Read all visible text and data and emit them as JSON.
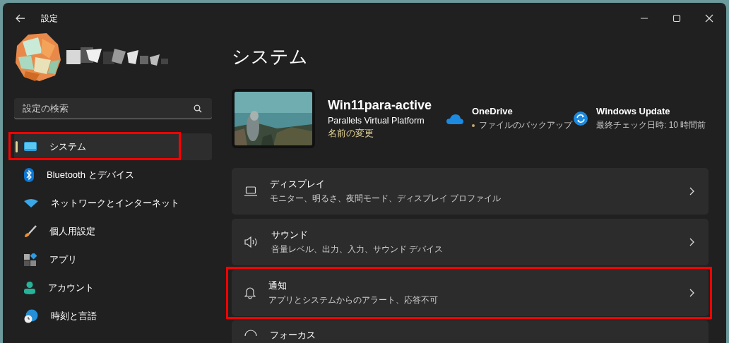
{
  "window": {
    "title": "設定"
  },
  "search": {
    "placeholder": "設定の検索"
  },
  "sidebar": {
    "items": [
      {
        "label": "システム",
        "selected": true,
        "highlighted": true
      },
      {
        "label": "Bluetooth とデバイス",
        "selected": false,
        "highlighted": false
      },
      {
        "label": "ネットワークとインターネット",
        "selected": false,
        "highlighted": false
      },
      {
        "label": "個人用設定",
        "selected": false,
        "highlighted": false
      },
      {
        "label": "アプリ",
        "selected": false,
        "highlighted": false
      },
      {
        "label": "アカウント",
        "selected": false,
        "highlighted": false
      },
      {
        "label": "時刻と言語",
        "selected": false,
        "highlighted": false
      }
    ]
  },
  "page": {
    "title": "システム"
  },
  "device": {
    "name": "Win11para-active",
    "model": "Parallels Virtual Platform",
    "rename_link": "名前の変更"
  },
  "status": [
    {
      "title": "OneDrive",
      "detail": "ファイルのバックアップ"
    },
    {
      "title": "Windows Update",
      "detail": "最終チェック日時: 10 時間前"
    }
  ],
  "settings": [
    {
      "title": "ディスプレイ",
      "subtitle": "モニター、明るさ、夜間モード、ディスプレイ プロファイル",
      "highlighted": false
    },
    {
      "title": "サウンド",
      "subtitle": "音量レベル、出力、入力、サウンド デバイス",
      "highlighted": false
    },
    {
      "title": "通知",
      "subtitle": "アプリとシステムからのアラート、応答不可",
      "highlighted": true
    },
    {
      "title": "フォーカス",
      "highlighted": false
    }
  ]
}
